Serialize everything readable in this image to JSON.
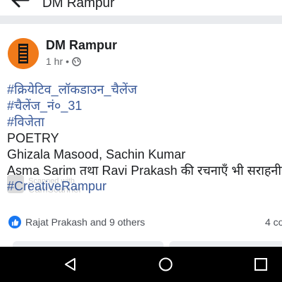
{
  "header": {
    "title": "DM Rampur",
    "back_icon": "arrow-left-icon"
  },
  "post": {
    "author": "DM Rampur",
    "time": "1 hr",
    "separator": "•",
    "audience_icon": "globe-icon",
    "hashtags": [
      "#क्रियेटिव_लॉकडाउन_चैलेंज",
      "#चैलेंज_नं०_31",
      "#विजेता"
    ],
    "text_lines": [
      "POETRY",
      "Ghizala Masood, Sachin Kumar",
      "Asma Sarim तथा Ravi Prakash की रचनाएँ भी सराहनीय"
    ],
    "last_hashtag": "#CreativeRampur",
    "watermark": {
      "line1": "Scanned with",
      "line2": "CamScanner"
    },
    "reactions": {
      "icon": "like-icon",
      "text": "Rajat Prakash and 9 others",
      "color": "#1877f2"
    },
    "comments": "4 co"
  },
  "navbar": {
    "back": "nav-back-icon",
    "home": "nav-home-icon",
    "recents": "nav-recents-icon"
  },
  "colors": {
    "hashtag": "#385898",
    "avatar": "#f07a1a",
    "background": "#e9ebee"
  }
}
